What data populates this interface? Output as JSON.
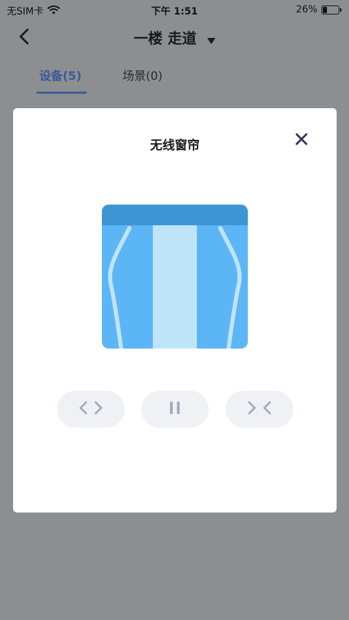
{
  "status": {
    "carrier": "无SIM卡",
    "time": "下午 1:51",
    "battery_percent": "26%",
    "battery_level": 0.26,
    "wifi_icon": "wifi-icon"
  },
  "nav": {
    "title": "一楼 走道",
    "back_icon": "chevron-left-icon",
    "dropdown_icon": "caret-down-icon"
  },
  "tabs": [
    {
      "label": "设备(5)",
      "active": true
    },
    {
      "label": "场景(0)",
      "active": false
    }
  ],
  "modal": {
    "title": "无线窗帘",
    "close_icon": "close-icon",
    "illustration": "curtain-icon",
    "controls": [
      {
        "name": "open",
        "icon": "open-curtain-icon"
      },
      {
        "name": "pause",
        "icon": "pause-icon"
      },
      {
        "name": "close",
        "icon": "close-curtain-icon"
      }
    ]
  },
  "colors": {
    "accent": "#3a5a98",
    "overlay": "#8d8e90",
    "curtain_blue": "#5cb6f5",
    "curtain_light": "#bfe4f9",
    "curtain_rail": "#3e95d3",
    "control_bg": "#f0f1f5",
    "control_icon": "#a6aabb"
  }
}
